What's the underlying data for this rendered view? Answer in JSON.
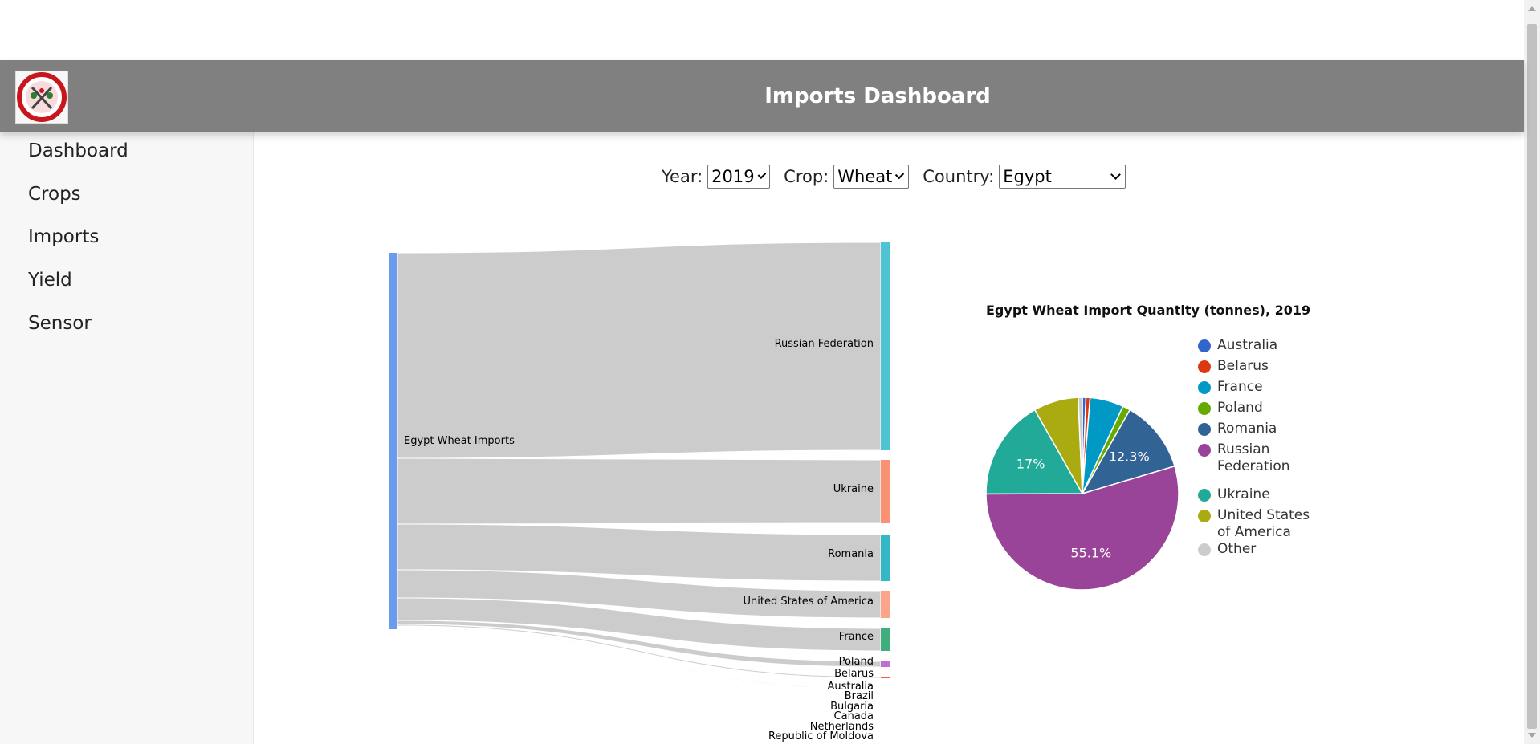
{
  "header": {
    "title": "Imports Dashboard",
    "logo": "crop-logo-icon"
  },
  "sidebar": {
    "items": [
      {
        "label": "Dashboard"
      },
      {
        "label": "Crops"
      },
      {
        "label": "Imports"
      },
      {
        "label": "Yield"
      },
      {
        "label": "Sensor"
      }
    ]
  },
  "filters": {
    "year": {
      "label": "Year:",
      "value": "2019"
    },
    "crop": {
      "label": "Crop:",
      "value": "Wheat"
    },
    "country": {
      "label": "Country:",
      "value": "Egypt"
    }
  },
  "chart_data": [
    {
      "type": "sankey",
      "source": "Egypt Wheat Imports",
      "targets": [
        {
          "name": "Russian Federation",
          "color": "#4fc3d3"
        },
        {
          "name": "Ukraine",
          "color": "#f99172"
        },
        {
          "name": "Romania",
          "color": "#35b7c7"
        },
        {
          "name": "United States of America",
          "color": "#fca58a"
        },
        {
          "name": "France",
          "color": "#3fae7c"
        },
        {
          "name": "Poland",
          "color": "#c06fd0"
        },
        {
          "name": "Belarus",
          "color": "#ef5a4a"
        },
        {
          "name": "Australia",
          "color": "#8aa8ef"
        },
        {
          "name": "Brazil",
          "color": "#999999"
        },
        {
          "name": "Bulgaria",
          "color": "#999999"
        },
        {
          "name": "Canada",
          "color": "#999999"
        },
        {
          "name": "Netherlands",
          "color": "#999999"
        },
        {
          "name": "Republic of Moldova",
          "color": "#999999"
        }
      ],
      "source_color": "#6b9bec",
      "link_color": "#cccccc"
    },
    {
      "type": "pie",
      "title": "Egypt Wheat Import Quantity (tonnes), 2019",
      "legend": "right",
      "slices": [
        {
          "label": "Australia",
          "value": 0.6,
          "color": "#3366cc",
          "pct_label": ""
        },
        {
          "label": "Belarus",
          "value": 0.7,
          "color": "#dc3912",
          "pct_label": ""
        },
        {
          "label": "France",
          "value": 5.7,
          "color": "#0099c6",
          "pct_label": ""
        },
        {
          "label": "Poland",
          "value": 1.3,
          "color": "#66aa00",
          "pct_label": ""
        },
        {
          "label": "Romania",
          "value": 12.3,
          "color": "#316395",
          "pct_label": "12.3%"
        },
        {
          "label": "Russian Federation",
          "value": 55.1,
          "color": "#994499",
          "pct_label": "55.1%"
        },
        {
          "label": "Ukraine",
          "value": 17,
          "color": "#22aa99",
          "pct_label": "17%"
        },
        {
          "label": "United States of America",
          "value": 7.6,
          "color": "#aaaa11",
          "pct_label": ""
        },
        {
          "label": "Other",
          "value": 0.7,
          "color": "#cccccc",
          "pct_label": ""
        }
      ]
    }
  ]
}
